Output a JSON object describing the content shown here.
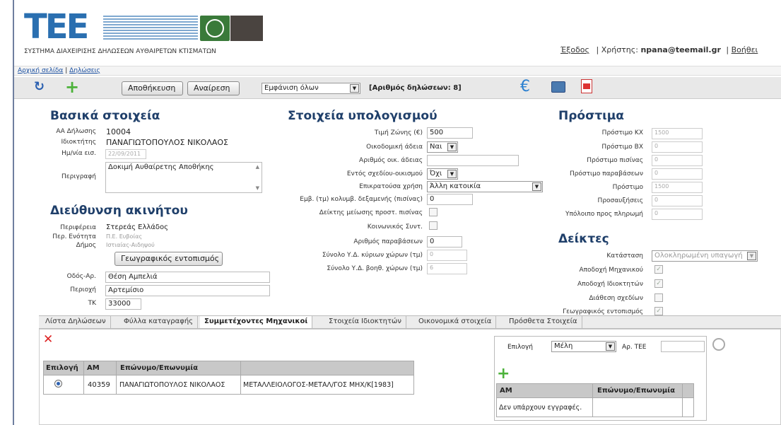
{
  "header": {
    "logo_text": "ΤΕΕ",
    "system_name": "ΣΥΣΤΗΜΑ ΔΙΑΧΕΙΡΙΣΗΣ ΔΗΛΩΣΕΩΝ ΑΥΘΑΙΡΕΤΩΝ ΚΤΙΣΜΑΤΩΝ",
    "exit_label": "Έξοδος",
    "sep1": "|",
    "user_label": "Χρήστης:",
    "user_email": "npana@teemail.gr",
    "sep2": "|",
    "help_label": "Βοήθει"
  },
  "breadcrumb": {
    "home": "Αρχική σελίδα",
    "sep": "|",
    "declarations": "Δηλώσεις"
  },
  "toolbar": {
    "save_label": "Αποθήκευση",
    "search_label": "Αναίρεση",
    "filter_value": "Εμφάνιση όλων",
    "count_text": "[Αριθμός δηλώσεων: 8]"
  },
  "basic": {
    "title": "Βασικά στοιχεία",
    "aa_label": "ΑΑ Δήλωσης",
    "aa_value": "10004",
    "owner_label": "Ιδιοκτήτης",
    "owner_value": "ΠΑΝΑΓΙΩΤΟΠΟΥΛΟΣ ΝΙΚΟΛΑΟΣ",
    "date_label": "Ημ/νία εισ.",
    "date_value": "22/09/2011",
    "desc_label": "Περιγραφή",
    "desc_value": "Δοκιμή Αυθαίρετης Αποθήκης"
  },
  "address": {
    "title": "Διεύθυνση ακινήτου",
    "region_label": "Περιφέρεια",
    "region_value": "Στερεάς Ελλάδος",
    "unit_label": "Περ. Ενότητα",
    "unit_value": "Π.Ε. Ευβοίας",
    "municipality_label": "Δήμος",
    "municipality_value": "Ιστιαίας-Αιδηψού",
    "geo_button": "Γεωγραφικός εντοπισμός",
    "street_label": "Οδός-Αρ.",
    "street_value": "Θέση Αμπελιά",
    "area_label": "Περιοχή",
    "area_value": "Αρτεμίσιο",
    "tk_label": "ΤΚ",
    "tk_value": "33000"
  },
  "calc": {
    "title": "Στοιχεία υπολογισμού",
    "zone_label": "Τιμή Ζώνης (€)",
    "zone_value": "500",
    "permit_label": "Οικοδομική άδεια",
    "permit_value": "Ναι",
    "permit_no_label": "Αριθμός οικ. άδειας",
    "permit_no_value": "",
    "plan_label": "Εντός σχεδίου-οικισμού",
    "plan_value": "Όχι",
    "use_label": "Επικρατούσα χρήση",
    "use_value": "Άλλη κατοικία",
    "pool_label": "Εμβ. (τμ) κολυμβ. δεξαμενής (πισίνας)",
    "pool_value": "0",
    "pool_idx_label": "Δείκτης μείωσης προστ. πισίνας",
    "social_label": "Κοινωνικός Συντ.",
    "violations_label": "Αριθμός παραβάσεων",
    "violations_value": "0",
    "main_area_label": "Σύνολο Υ.Δ. κύριων χώρων (τμ)",
    "main_area_value": "0",
    "aux_area_label": "Σύνολο Υ.Δ. βοηθ. χώρων (τμ)",
    "aux_area_value": "6"
  },
  "fines": {
    "title": "Πρόστιμα",
    "kx_label": "Πρόστιμο ΚΧ",
    "kx_value": "1500",
    "bx_label": "Πρόστιμο ΒΧ",
    "bx_value": "0",
    "pool_label": "Πρόστιμο πισίνας",
    "pool_value": "0",
    "viol_label": "Πρόστιμο παραβάσεων",
    "viol_value": "0",
    "fine_label": "Πρόστιμο",
    "fine_value": "1500",
    "surcharge_label": "Προσαυξήσεις",
    "surcharge_value": "0",
    "remaining_label": "Υπόλοιπο προς πληρωμή",
    "remaining_value": "0"
  },
  "indicators": {
    "title": "Δείκτες",
    "status_label": "Κατάσταση",
    "status_value": "Ολοκληρωμένη υπαγωγή",
    "eng_label": "Αποδοχή Μηχανικού",
    "owner_label": "Αποδοχή Ιδιοκτητών",
    "plans_label": "Διάθεση σχεδίων",
    "geo_label": "Γεωγραφικός εντοπισμός"
  },
  "tabs": [
    "Λίστα Δηλώσεων",
    "Φύλλα καταγραφής",
    "Συμμετέχοντες Μηχανικοί",
    "Στοιχεία Ιδιοκτητών",
    "Οικονομικά στοιχεία",
    "Πρόσθετα Στοιχεία"
  ],
  "engineers": {
    "headers": [
      "Επιλογή",
      "ΑΜ",
      "Επώνυμο/Επωνυμία",
      ""
    ],
    "row": {
      "am": "40359",
      "name": "ΠΑΝΑΓΙΩΤΟΠΟΥΛΟΣ ΝΙΚΟΛΑΟΣ",
      "specialty": "ΜΕΤΑΛΛΕΙΟΛΟΓΟΣ-ΜΕΤΑΛ/ΓΟΣ ΜΗΧ/Κ[1983]"
    }
  },
  "member_search": {
    "choice_label": "Επιλογή",
    "choice_value": "Μέλη",
    "tee_label": "Αρ. ΤΕΕ",
    "tee_value": "",
    "headers": [
      "ΑΜ",
      "Επώνυμο/Επωνυμία"
    ],
    "empty_text": "Δεν υπάρχουν εγγραφές."
  },
  "colors": {
    "accent": "#1f3f6a",
    "tee_blue": "#2a6fb0",
    "logo_green": "#3a7a3a",
    "toolbar_bg": "#e8e8e8"
  }
}
